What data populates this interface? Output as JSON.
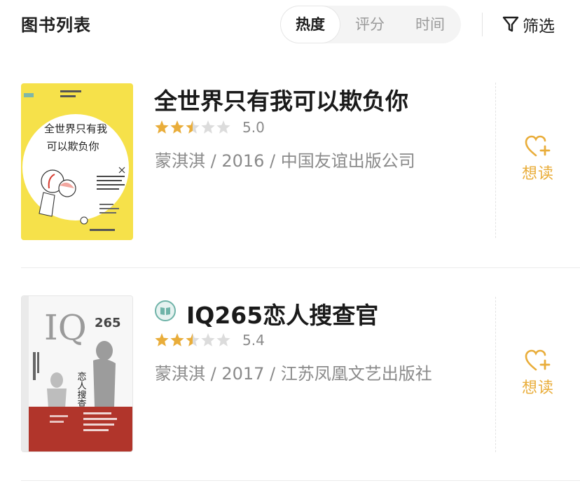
{
  "header": {
    "title": "图书列表",
    "sort_tabs": [
      {
        "label": "热度",
        "active": true
      },
      {
        "label": "评分",
        "active": false
      },
      {
        "label": "时间",
        "active": false
      }
    ],
    "filter_label": "筛选",
    "filter_icon": "filter-funnel-icon"
  },
  "books": [
    {
      "title": "全世界只有我可以欺负你",
      "rating_stars": 2.5,
      "score": "5.0",
      "meta": "蒙淇淇 / 2016 / 中国友谊出版公司",
      "cover_text": "全世界只有我可以欺负你",
      "want_label": "想读",
      "want_icon": "heart-plus-icon"
    },
    {
      "title": "IQ265恋人搜查官",
      "badge_icon": "ebook-icon",
      "rating_stars": 2.5,
      "score": "5.4",
      "meta": "蒙淇淇 / 2017 / 江苏凤凰文艺出版社",
      "cover_text_big": "IQ",
      "cover_text_num": "265",
      "cover_text_sub": "恋人搜查官",
      "want_label": "想读",
      "want_icon": "heart-plus-icon"
    }
  ],
  "colors": {
    "accent": "#e9ad3a",
    "star_filled": "#e9ad3a",
    "star_empty": "#dcdcdc",
    "badge": "#6fb3a8"
  }
}
